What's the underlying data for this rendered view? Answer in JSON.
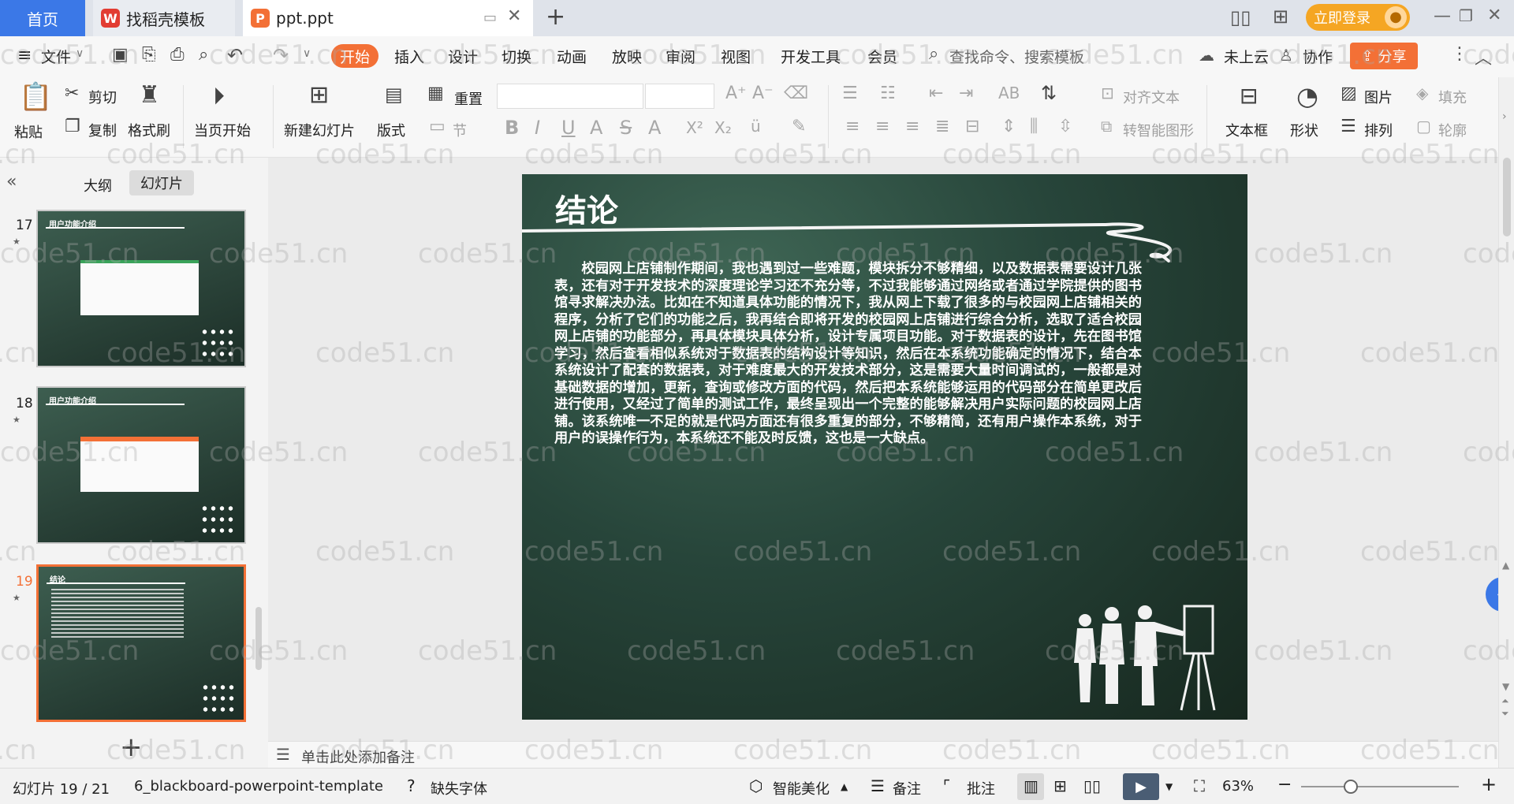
{
  "tabs": {
    "home": "首页",
    "template": "找稻壳模板",
    "document": "ppt.ppt",
    "badge_template": "W",
    "badge_doc": "P"
  },
  "login": "立即登录",
  "menu": {
    "file": "文件",
    "start": "开始",
    "insert": "插入",
    "design": "设计",
    "transition": "切换",
    "animation": "动画",
    "slideshow": "放映",
    "review": "审阅",
    "view": "视图",
    "devtools": "开发工具",
    "member": "会员",
    "search": "查找命令、搜索模板",
    "cloud": "未上云",
    "collab": "协作",
    "share": "分享"
  },
  "ribbon": {
    "paste": "粘贴",
    "cut": "剪切",
    "copy": "复制",
    "format_painter": "格式刷",
    "from_current": "当页开始",
    "new_slide": "新建幻灯片",
    "layout": "版式",
    "section": "节",
    "reset": "重置",
    "align_text": "对齐文本",
    "smart_shape": "转智能图形",
    "textbox": "文本框",
    "shape": "形状",
    "picture": "图片",
    "arrange": "排列",
    "fill": "填充",
    "outline": "轮廓"
  },
  "left_panel": {
    "outline_tab": "大纲",
    "slides_tab": "幻灯片",
    "slides": [
      {
        "number": "17",
        "title": "用户功能介绍"
      },
      {
        "number": "18",
        "title": "用户功能介绍"
      },
      {
        "number": "19",
        "title": "结论"
      }
    ]
  },
  "slide": {
    "title": "结论",
    "body": "校园网上店铺制作期间，我也遇到过一些难题，模块拆分不够精细，以及数据表需要设计几张表，还有对于开发技术的深度理论学习还不充分等，不过我能够通过网络或者通过学院提供的图书馆寻求解决办法。比如在不知道具体功能的情况下，我从网上下载了很多的与校园网上店铺相关的程序，分析了它们的功能之后，我再结合即将开发的校园网上店铺进行综合分析，选取了适合校园网上店铺的功能部分，再具体模块具体分析，设计专属项目功能。对于数据表的设计，先在图书馆学习，然后查看相似系统对于数据表的结构设计等知识，然后在本系统功能确定的情况下，结合本系统设计了配套的数据表，对于难度最大的开发技术部分，这是需要大量时间调试的，一般都是对基础数据的增加，更新，查询或修改方面的代码，然后把本系统能够运用的代码部分在简单更改后进行使用，又经过了简单的测试工作，最终呈现出一个完整的能够解决用户实际问题的校园网上店铺。该系统唯一不足的就是代码方面还有很多重复的部分，不够精简，还有用户操作本系统，对于用户的误操作行为，本系统还不能及时反馈，这也是一大缺点。"
  },
  "notes_placeholder": "单击此处添加备注",
  "status": {
    "slide_counter": "幻灯片 19 / 21",
    "template_name": "6_blackboard-powerpoint-template",
    "missing_font": "缺失字体",
    "beautify": "智能美化",
    "notes": "备注",
    "comments": "批注",
    "zoom": "63%"
  },
  "watermark": "code51.cn",
  "colors": {
    "accent": "#f37036",
    "home_tab": "#3b78e7",
    "login": "#f5a623"
  }
}
